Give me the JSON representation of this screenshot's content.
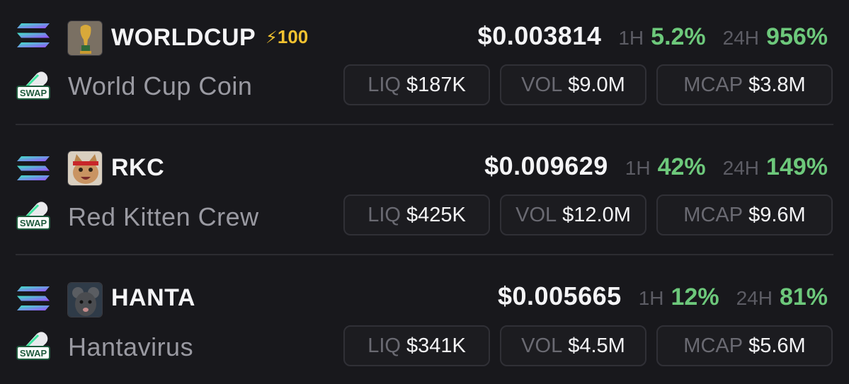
{
  "colors": {
    "background": "#18181c",
    "positive": "#6dc87b",
    "boost": "#f2c230",
    "muted": "#9a9aa2"
  },
  "tokens": [
    {
      "symbol": "WORLDCUP",
      "boost": "100",
      "name": "World Cup Coin",
      "avatar_icon": "world-cup-trophy-icon",
      "price": "$0.003814",
      "h1_label": "1H",
      "h1": "5.2%",
      "h24_label": "24H",
      "h24": "956%",
      "liq_label": "LIQ",
      "liq": "$187K",
      "vol_label": "VOL",
      "vol": "$9.0M",
      "mcap_label": "MCAP",
      "mcap": "$3.8M"
    },
    {
      "symbol": "RKC",
      "name": "Red Kitten Crew",
      "avatar_icon": "cat-with-headband-icon",
      "price": "$0.009629",
      "h1_label": "1H",
      "h1": "42%",
      "h24_label": "24H",
      "h24": "149%",
      "liq_label": "LIQ",
      "liq": "$425K",
      "vol_label": "VOL",
      "vol": "$12.0M",
      "mcap_label": "MCAP",
      "mcap": "$9.6M"
    },
    {
      "symbol": "HANTA",
      "name": "Hantavirus",
      "avatar_icon": "rat-icon",
      "price": "$0.005665",
      "h1_label": "1H",
      "h1": "12%",
      "h24_label": "24H",
      "h24": "81%",
      "liq_label": "LIQ",
      "liq": "$341K",
      "vol_label": "VOL",
      "vol": "$4.5M",
      "mcap_label": "MCAP",
      "mcap": "$5.6M"
    }
  ],
  "swap_badge_label": "SWAP",
  "chain_icon": "solana-icon"
}
